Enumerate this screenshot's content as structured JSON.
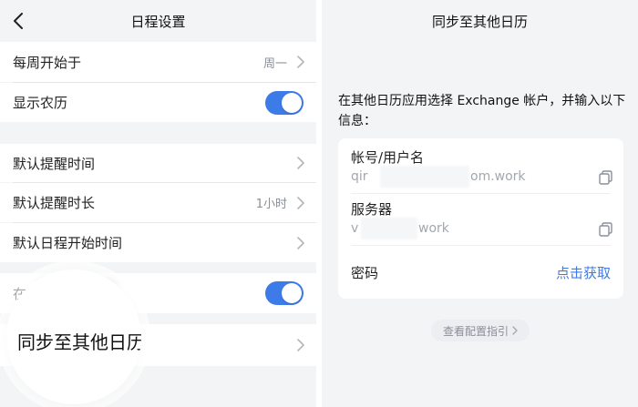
{
  "left": {
    "title": "日程设置",
    "rows": {
      "week_start": {
        "label": "每周开始于",
        "value": "周一"
      },
      "lunar": {
        "label": "显示农历",
        "enabled": true
      },
      "reminder_time": {
        "label": "默认提醒时间"
      },
      "reminder_duration": {
        "label": "默认提醒时长",
        "value": "1小时"
      },
      "start_time": {
        "label": "默认日程开始时间"
      },
      "hidden_toggle": {
        "label": "在",
        "enabled": true
      },
      "sync": {
        "label": "同步至其他日历"
      }
    }
  },
  "right": {
    "title": "同步至其他日历",
    "instruction": "在其他日历应用选择 Exchange 帐户，并输入以下信息：",
    "account": {
      "label": "帐号/用户名",
      "value_visible_start": "qir",
      "value_visible_end": "om.work"
    },
    "server": {
      "label": "服务器",
      "value_visible_start": "v",
      "value_visible_end": "work"
    },
    "password": {
      "label": "密码",
      "action": "点击获取"
    },
    "guide_label": "查看配置指引"
  },
  "colors": {
    "accent": "#3d7be8",
    "background": "#f3f4f6",
    "muted": "#8a8f98"
  },
  "icons": [
    "back-chevron-icon",
    "chevron-right-icon",
    "copy-icon"
  ]
}
